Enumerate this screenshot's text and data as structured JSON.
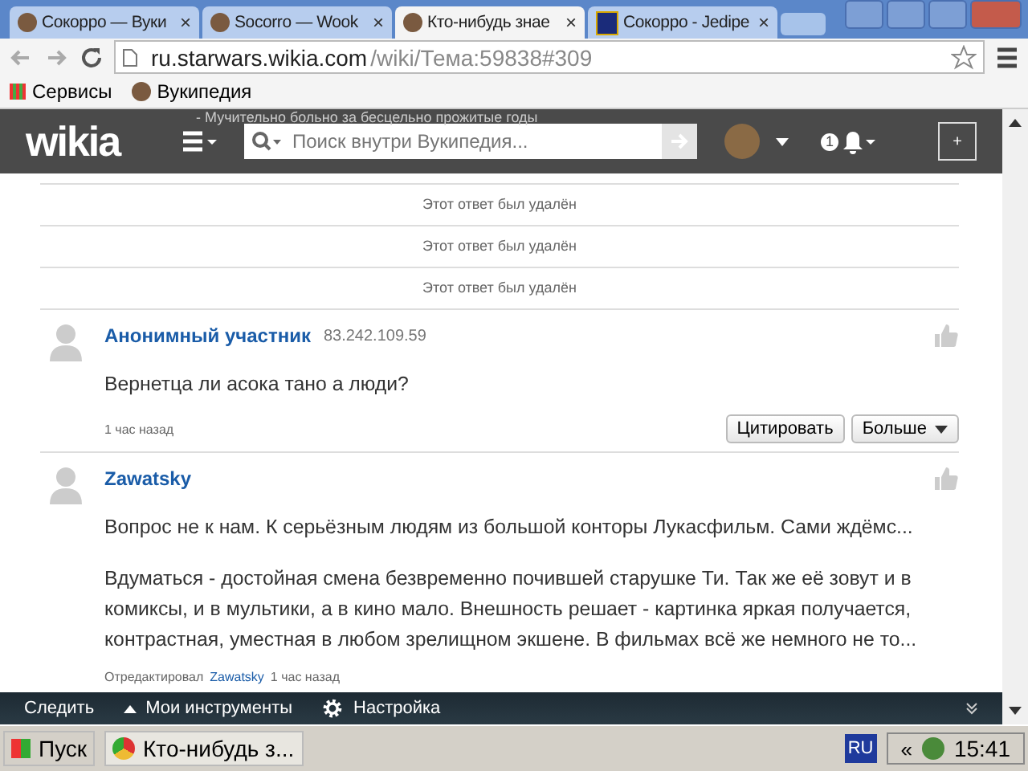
{
  "browser": {
    "tabs": [
      {
        "title": "Сокорро — Вуки",
        "selected": false
      },
      {
        "title": "Socorro — Wook",
        "selected": false
      },
      {
        "title": "Кто-нибудь знае",
        "selected": true
      },
      {
        "title": "Сокорро - Jedipe",
        "selected": false
      }
    ],
    "url_host": "ru.starwars.wikia.com",
    "url_path": "/wiki/Тема:59838#309",
    "bookmarks": [
      "Сервисы",
      "Вукипедия"
    ]
  },
  "header": {
    "logo": "wikia",
    "search_placeholder": "Поиск внутри Вукипедия...",
    "notification_count": "1",
    "plus": "+",
    "overlapped_text": "- Мучительно больно за бесцельно прожитые годы"
  },
  "deleted_replies": [
    "Этот ответ был удалён",
    "Этот ответ был удалён",
    "Этот ответ был удалён"
  ],
  "posts": [
    {
      "author": "Анонимный участник",
      "ip": "83.242.109.59",
      "paragraphs": [
        "Вернетца ли асока тано а люди?"
      ],
      "time": "1 час назад",
      "buttons": [
        "Цитировать",
        "Больше"
      ]
    },
    {
      "author": "Zawatsky",
      "paragraphs": [
        "Вопрос не к нам. К серьёзным людям из большой конторы Лукасфильм. Сами ждёмс...",
        "Вдуматься - достойная смена безвременно почившей старушке Ти. Так же её зовут и в комиксы, и в мультики, а в кино мало. Внешность решает - картинка яркая получается, контрастная, уместная в любом зрелищном экшене. В фильмах всё же немного не то..."
      ],
      "edited_by_label": "Отредактировал",
      "edited_by": "Zawatsky",
      "time": "1 час назад"
    }
  ],
  "toolbar": [
    "Следить",
    "Мои инструменты",
    "Настройка"
  ],
  "tab_close": "×",
  "taskbar": {
    "start": "Пуск",
    "window": "Кто-нибудь з...",
    "lang": "RU",
    "tray_arrows": "«",
    "clock": "15:41"
  }
}
